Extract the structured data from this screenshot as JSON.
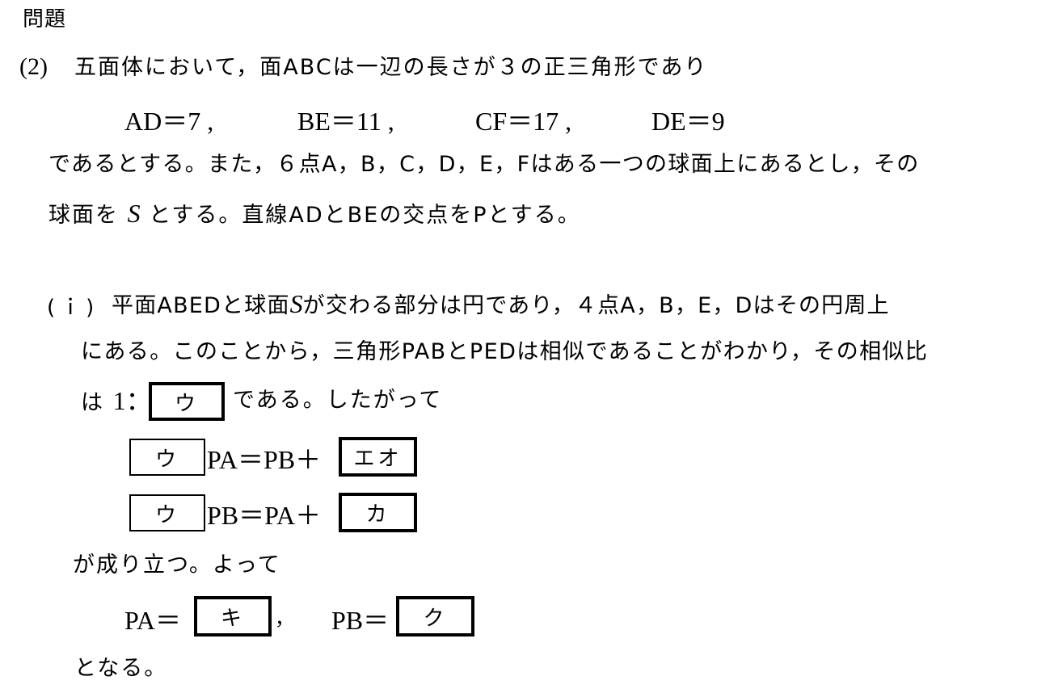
{
  "header": {
    "title": "問題"
  },
  "problem": {
    "number": "(2)",
    "intro": "五面体において，面ABCは一辺の長さが３の正三角形であり",
    "conditions": [
      {
        "label": "AD",
        "eq": "＝",
        "value": "7",
        "sep": ","
      },
      {
        "label": "BE",
        "eq": "＝",
        "value": "11",
        "sep": ","
      },
      {
        "label": "CF",
        "eq": "＝",
        "value": "17",
        "sep": ","
      },
      {
        "label": "DE",
        "eq": "＝",
        "value": "9",
        "sep": ""
      }
    ],
    "line3": "であるとする。また，６点A，B，C，D，E，Fはある一つの球面上にあるとし，その",
    "line4_pre": "球面を",
    "line4_var": "S",
    "line4_post": "とする。直線ADとBEの交点をPとする。"
  },
  "subproblem": {
    "label": "(ｉ)",
    "line1_pre": "平面ABEDと球面",
    "line1_var": "S",
    "line1_post": "が交わる部分は円であり，４点A，B，E，Dはその円周上",
    "line2": "にある。このことから，三角形PABとPEDは相似であることがわかり，その相似比",
    "line3_pre": "は",
    "line3_ratio": "1：",
    "line3_post": "である。したがって",
    "eq1": {
      "left_suffix": "PA＝PB＋"
    },
    "eq2": {
      "left_suffix": "PB＝PA＋"
    },
    "conclusion": "が成り立つ。よって",
    "result": {
      "pa_label": "PA＝",
      "comma": ",",
      "pb_label": "PB＝"
    },
    "ending": "となる。"
  },
  "answer_boxes": {
    "u": "ウ",
    "eo": "エオ",
    "ka": "カ",
    "ki": "キ",
    "ku": "ク"
  }
}
